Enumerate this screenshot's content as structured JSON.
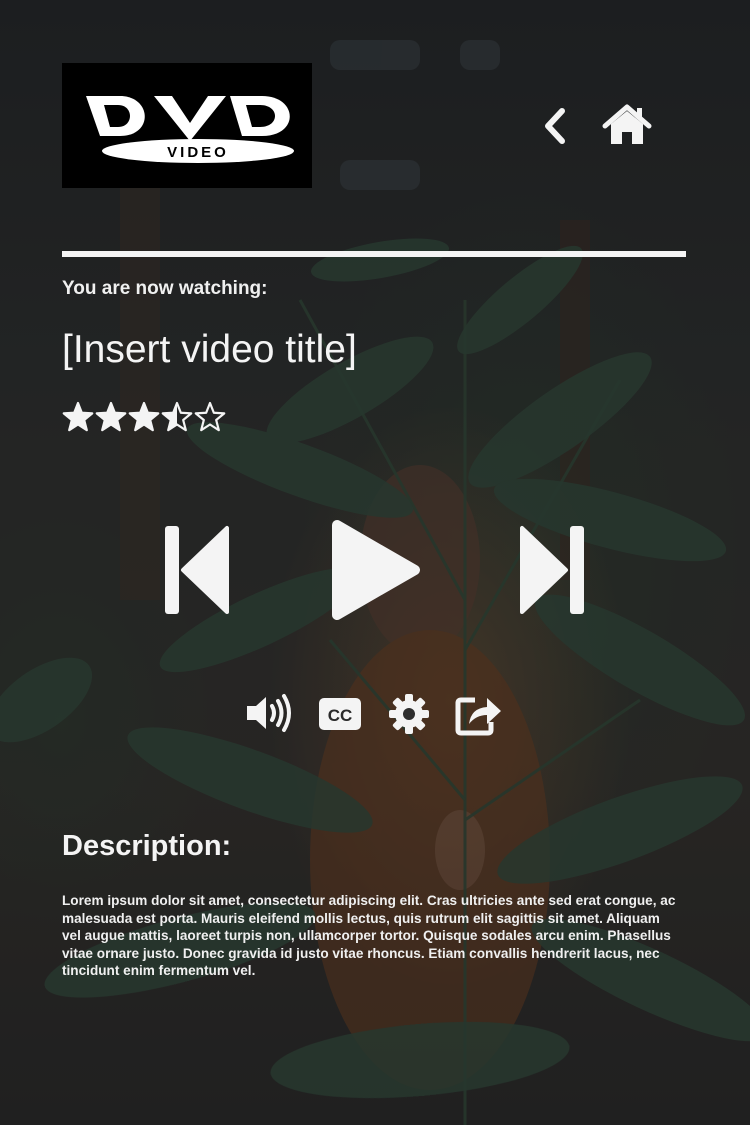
{
  "logo": {
    "text": "DVD",
    "subtext": "VIDEO"
  },
  "nav": {
    "back_icon": "chevron-left-icon",
    "home_icon": "home-icon"
  },
  "now_playing": {
    "label": "You are now watching:",
    "title": "[Insert video title]",
    "rating": 3.5,
    "rating_max": 5
  },
  "controls": {
    "primary": [
      "skip-previous-icon",
      "play-icon",
      "skip-next-icon"
    ],
    "secondary": [
      "volume-icon",
      "closed-captions-icon",
      "gear-icon",
      "share-icon"
    ],
    "cc_text": "CC"
  },
  "description": {
    "heading": "Description:",
    "body": "Lorem ipsum dolor sit amet, consectetur adipiscing elit. Cras ultricies ante sed erat congue, ac malesuada est porta. Mauris eleifend mollis lectus, quis rutrum elit sagittis sit amet. Aliquam vel augue mattis, laoreet turpis non, ullamcorper tortor. Quisque sodales arcu enim. Phasellus vitae ornare justo. Donec gravida id justo vitae rhoncus. Etiam convallis hendrerit lacus, nec tincidunt enim fermentum vel."
  },
  "colors": {
    "foreground": "#f4f4f4",
    "logo_background": "#000000"
  }
}
